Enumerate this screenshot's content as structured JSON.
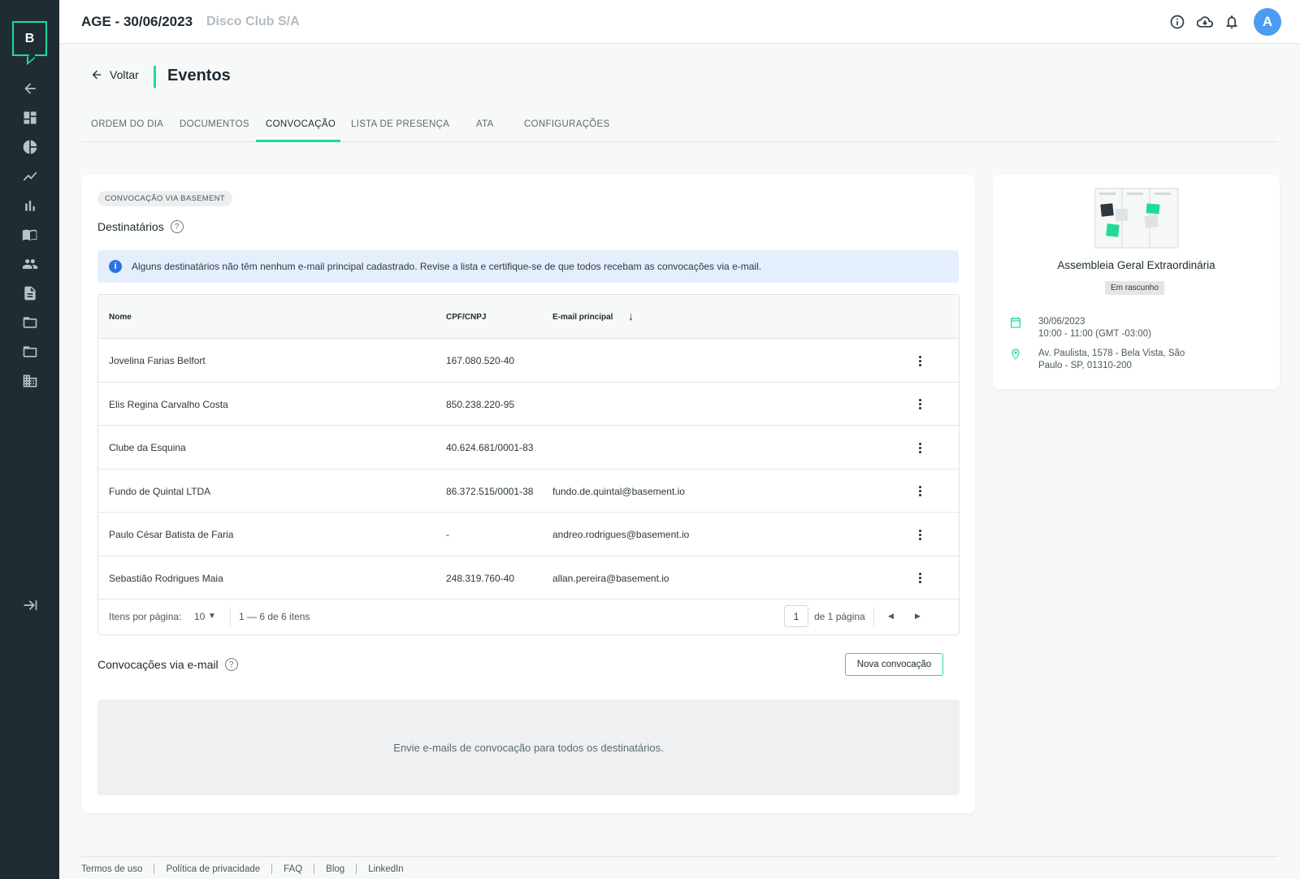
{
  "sidebar": {
    "logo_letter": "B",
    "icons": [
      "back-arrow-icon",
      "dashboard-icon",
      "pie-chart-icon",
      "trending-icon",
      "bar-chart-icon",
      "book-icon",
      "people-icon",
      "document-icon",
      "folder-icon",
      "folder-outline-icon",
      "building-icon",
      "expand-icon"
    ]
  },
  "topbar": {
    "title": "AGE - 30/06/2023",
    "company": "Disco Club S/A",
    "avatar_letter": "A"
  },
  "header": {
    "back_label": "Voltar",
    "page_title": "Eventos"
  },
  "tabs": [
    {
      "label": "ORDEM DO DIA",
      "active": false
    },
    {
      "label": "DOCUMENTOS",
      "active": false
    },
    {
      "label": "CONVOCAÇÃO",
      "active": true
    },
    {
      "label": "LISTA DE PRESENÇA",
      "active": false
    },
    {
      "label": "ATA",
      "active": false
    },
    {
      "label": "CONFIGURAÇÕES",
      "active": false
    }
  ],
  "main": {
    "chip": "CONVOCAÇÃO VIA BASEMENT",
    "recipients_title": "Destinatários",
    "alert_text": "Alguns destinatários não têm nenhum e-mail principal cadastrado. Revise a lista e certifique-se de que todos recebam as convocações via e-mail.",
    "table": {
      "headers": {
        "name": "Nome",
        "doc": "CPF/CNPJ",
        "email": "E-mail principal"
      },
      "rows": [
        {
          "name": "Jovelina Farias Belfort",
          "doc": "167.080.520-40",
          "email": ""
        },
        {
          "name": "Elis Regina Carvalho Costa",
          "doc": "850.238.220-95",
          "email": ""
        },
        {
          "name": "Clube da Esquina",
          "doc": "40.624.681/0001-83",
          "email": ""
        },
        {
          "name": "Fundo de Quintal LTDA",
          "doc": "86.372.515/0001-38",
          "email": "fundo.de.quintal@basement.io"
        },
        {
          "name": "Paulo César Batista de Faria",
          "doc": "-",
          "email": "andreo.rodrigues@basement.io"
        },
        {
          "name": "Sebastião Rodrigues Maia",
          "doc": "248.319.760-40",
          "email": "allan.pereira@basement.io"
        }
      ],
      "footer": {
        "items_per_page_label": "Itens por página:",
        "items_per_page": "10",
        "range": "1 — 6 de 6 itens",
        "page": "1",
        "of_pages": "de 1 página"
      }
    },
    "email_title": "Convocações via e-mail",
    "new_button": "Nova convocação",
    "empty_text": "Envie e-mails de convocação para todos os destinatários."
  },
  "event": {
    "name": "Assembleia Geral Extraordinária",
    "status": "Em rascunho",
    "date": "30/06/2023",
    "time": "10:00 - 11:00 (GMT -03:00)",
    "address_line1": "Av. Paulista, 1578 - Bela Vista, São",
    "address_line2": "Paulo - SP, 01310-200"
  },
  "footer": {
    "links": [
      "Termos de uso",
      "Política de privacidade",
      "FAQ",
      "Blog",
      "LinkedIn"
    ]
  },
  "colors": {
    "accent": "#1fdc95",
    "sidebar": "#1f2d33",
    "info": "#2a74e6"
  }
}
